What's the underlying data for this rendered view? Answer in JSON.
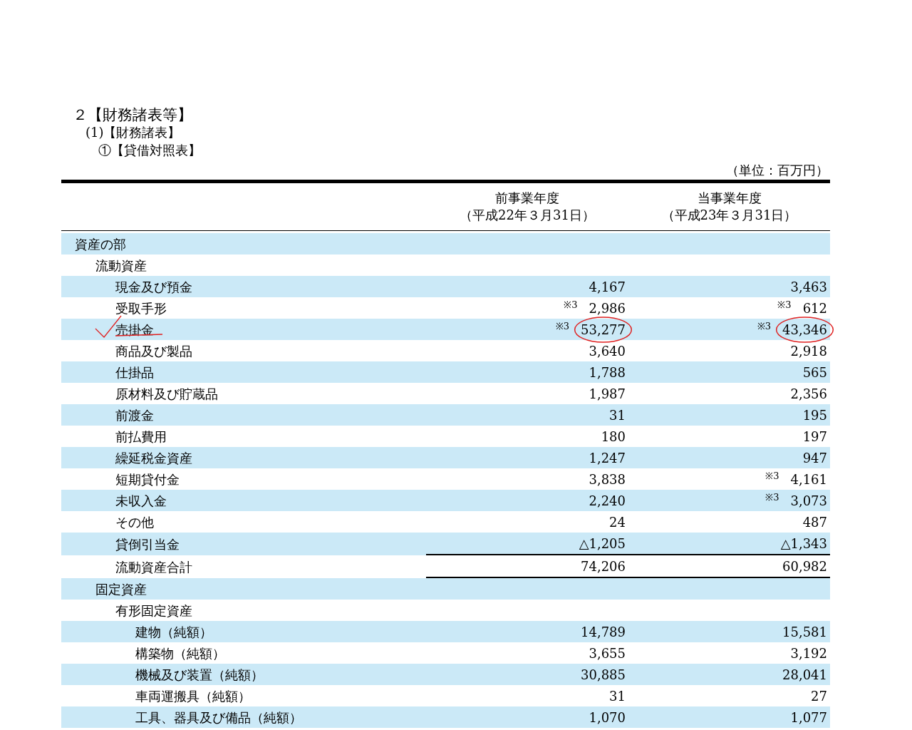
{
  "headings": [
    "２【財務諸表等】",
    "(1)【財務諸表】",
    "①【貸借対照表】"
  ],
  "unit": "（単位：百万円）",
  "columns": [
    {
      "title": "前事業年度",
      "date": "（平成22年３月31日）"
    },
    {
      "title": "当事業年度",
      "date": "（平成23年３月31日）"
    }
  ],
  "rows": [
    {
      "label": "資産の部",
      "children": [
        {
          "label": "流動資産",
          "children": [
            {
              "label": "現金及び預金",
              "prev": "4,167",
              "cur": "3,463"
            },
            {
              "label": "受取手形",
              "prev_note": "※3",
              "prev": "2,986",
              "cur_note": "※3",
              "cur": "612"
            },
            {
              "label": "売掛金",
              "checked": true,
              "prev_note": "※3",
              "prev": "53,277",
              "prev_circled": true,
              "cur_note": "※3",
              "cur": "43,346",
              "cur_circled": true
            },
            {
              "label": "商品及び製品",
              "prev": "3,640",
              "cur": "2,918"
            },
            {
              "label": "仕掛品",
              "prev": "1,788",
              "cur": "565"
            },
            {
              "label": "原材料及び貯蔵品",
              "prev": "1,987",
              "cur": "2,356"
            },
            {
              "label": "前渡金",
              "prev": "31",
              "cur": "195"
            },
            {
              "label": "前払費用",
              "prev": "180",
              "cur": "197"
            },
            {
              "label": "繰延税金資産",
              "prev": "1,247",
              "cur": "947"
            },
            {
              "label": "短期貸付金",
              "prev": "3,838",
              "cur_note": "※3",
              "cur": "4,161"
            },
            {
              "label": "未収入金",
              "prev": "2,240",
              "cur_note": "※3",
              "cur": "3,073"
            },
            {
              "label": "その他",
              "prev": "24",
              "cur": "487"
            },
            {
              "label": "貸倒引当金",
              "prev": "△1,205",
              "cur": "△1,343",
              "rule_below": true
            },
            {
              "label": "流動資産合計",
              "prev": "74,206",
              "cur": "60,982",
              "rule_below": true
            }
          ]
        },
        {
          "label": "固定資産",
          "children": [
            {
              "label": "有形固定資産",
              "children": [
                {
                  "label": "建物（純額）",
                  "prev": "14,789",
                  "cur": "15,581"
                },
                {
                  "label": "構築物（純額）",
                  "prev": "3,655",
                  "cur": "3,192"
                },
                {
                  "label": "機械及び装置（純額）",
                  "prev": "30,885",
                  "cur": "28,041"
                },
                {
                  "label": "車両運搬具（純額）",
                  "prev": "31",
                  "cur": "27"
                },
                {
                  "label": "工具、器具及び備品（純額）",
                  "prev": "1,070",
                  "cur": "1,077"
                }
              ]
            }
          ]
        }
      ]
    }
  ]
}
